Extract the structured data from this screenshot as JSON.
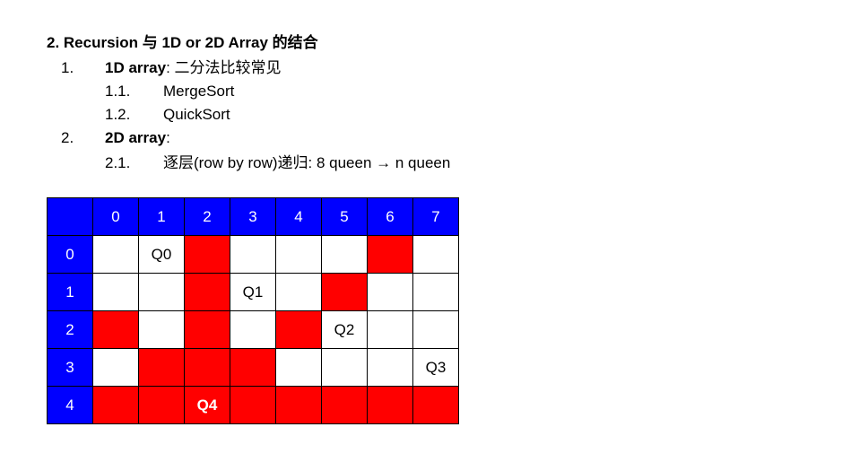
{
  "heading": "2. Recursion 与 1D or 2D Array 的结合",
  "items": [
    {
      "num": "1.",
      "label": "1D array",
      "rest": ":  二分法比较常见"
    },
    {
      "num": "1.1.",
      "text": "MergeSort"
    },
    {
      "num": "1.2.",
      "text": "QuickSort"
    },
    {
      "num": "2.",
      "label": "2D array",
      "rest": ":"
    },
    {
      "num": "2.1.",
      "text": "逐层(row by row)递归: 8 queen  → n queen"
    }
  ],
  "board": {
    "col_headers": [
      "",
      "0",
      "1",
      "2",
      "3",
      "4",
      "5",
      "6",
      "7"
    ],
    "rows": [
      {
        "header": "0",
        "cells": [
          {
            "text": "",
            "color": "white"
          },
          {
            "text": "Q0",
            "color": "white"
          },
          {
            "text": "",
            "color": "red"
          },
          {
            "text": "",
            "color": "white"
          },
          {
            "text": "",
            "color": "white"
          },
          {
            "text": "",
            "color": "white"
          },
          {
            "text": "",
            "color": "red"
          },
          {
            "text": "",
            "color": "white"
          }
        ]
      },
      {
        "header": "1",
        "cells": [
          {
            "text": "",
            "color": "white"
          },
          {
            "text": "",
            "color": "white"
          },
          {
            "text": "",
            "color": "red"
          },
          {
            "text": "Q1",
            "color": "white"
          },
          {
            "text": "",
            "color": "white"
          },
          {
            "text": "",
            "color": "red"
          },
          {
            "text": "",
            "color": "white"
          },
          {
            "text": "",
            "color": "white"
          }
        ]
      },
      {
        "header": "2",
        "cells": [
          {
            "text": "",
            "color": "red"
          },
          {
            "text": "",
            "color": "white"
          },
          {
            "text": "",
            "color": "red"
          },
          {
            "text": "",
            "color": "white"
          },
          {
            "text": "",
            "color": "red"
          },
          {
            "text": "Q2",
            "color": "white"
          },
          {
            "text": "",
            "color": "white"
          },
          {
            "text": "",
            "color": "white"
          }
        ]
      },
      {
        "header": "3",
        "cells": [
          {
            "text": "",
            "color": "white"
          },
          {
            "text": "",
            "color": "red"
          },
          {
            "text": "",
            "color": "red"
          },
          {
            "text": "",
            "color": "red"
          },
          {
            "text": "",
            "color": "white"
          },
          {
            "text": "",
            "color": "white"
          },
          {
            "text": "",
            "color": "white"
          },
          {
            "text": "Q3",
            "color": "white"
          }
        ]
      },
      {
        "header": "4",
        "cells": [
          {
            "text": "",
            "color": "red"
          },
          {
            "text": "",
            "color": "red"
          },
          {
            "text": "Q4",
            "color": "red",
            "bold": true
          },
          {
            "text": "",
            "color": "red"
          },
          {
            "text": "",
            "color": "red"
          },
          {
            "text": "",
            "color": "red"
          },
          {
            "text": "",
            "color": "red"
          },
          {
            "text": "",
            "color": "red"
          }
        ]
      }
    ]
  },
  "colors": {
    "header_blue": "#0000ff",
    "attack_red": "#ff0000",
    "empty_white": "#ffffff"
  }
}
